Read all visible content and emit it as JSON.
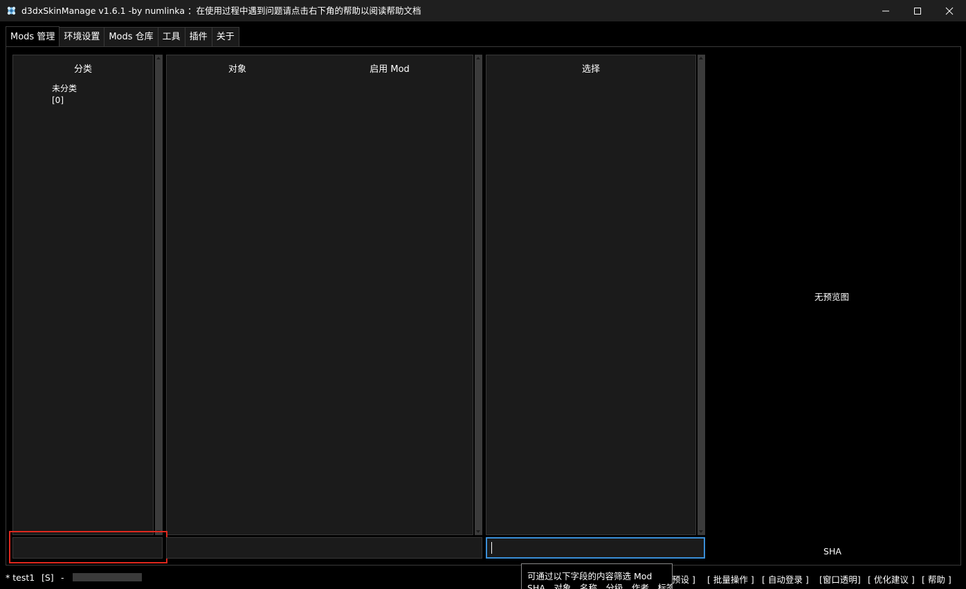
{
  "window": {
    "title": "d3dxSkinManage v1.6.1 -by numlinka ：在使用过程中遇到问题请点击右下角的帮助以阅读帮助文档",
    "controls": [
      "minimize-icon",
      "maximize-icon",
      "close-icon"
    ]
  },
  "tabs": [
    {
      "label": "Mods 管理",
      "active": true
    },
    {
      "label": "环境设置",
      "active": false
    },
    {
      "label": "Mods 仓库",
      "active": false
    },
    {
      "label": "工具",
      "active": false
    },
    {
      "label": "插件",
      "active": false
    },
    {
      "label": "关于",
      "active": false
    }
  ],
  "category_panel": {
    "header": "分类",
    "items": [
      {
        "name": "未分类",
        "count": "[0]"
      }
    ],
    "filter_value": ""
  },
  "object_panel": {
    "header_object": "对象",
    "header_enabled": "启用 Mod",
    "filter_value": ""
  },
  "select_panel": {
    "header": "选择",
    "search_value": ""
  },
  "preview": {
    "no_preview": "无预览图",
    "sha_label": "SHA"
  },
  "tooltip": {
    "line1": "可通过以下字段的内容筛选 Mod",
    "line2": "SHA、对象、名称、分级、作者、标签"
  },
  "status": {
    "user": "* test1",
    "flag": "[S]",
    "sep": "-",
    "links": [
      "预设 ]",
      "[ 批量操作 ]",
      "[ 自动登录 ]",
      "[窗口透明]",
      "[ 优化建议 ]",
      "[ 帮助 ]"
    ]
  },
  "colors": {
    "accent": "#3a8fd8",
    "highlight": "#e0281e"
  }
}
